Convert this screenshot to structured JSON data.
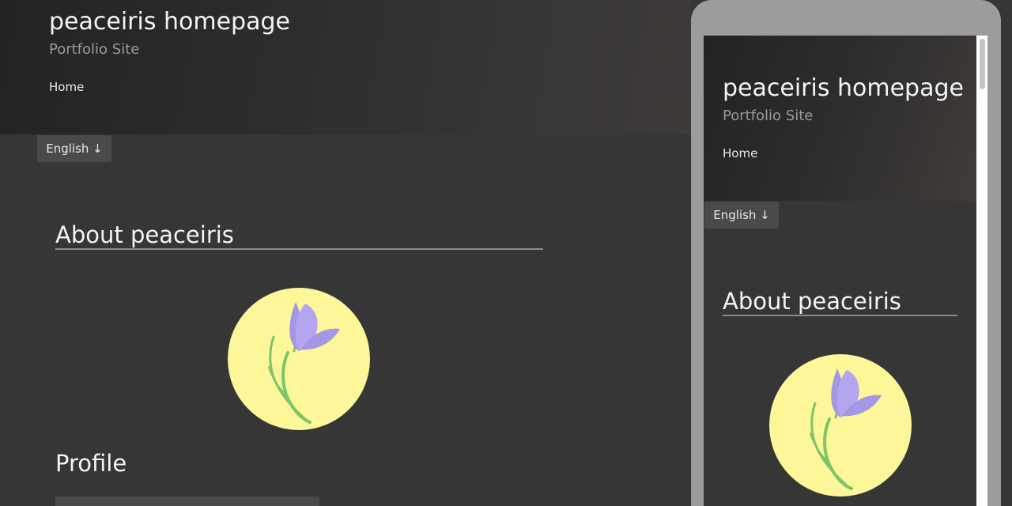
{
  "site": {
    "title": "peaceiris homepage",
    "subtitle": "Portfolio Site",
    "nav": {
      "home_label": "Home"
    },
    "language_button_label": "English ↓"
  },
  "main": {
    "about_heading": "About peaceiris",
    "profile_heading": "Profile",
    "avatar": {
      "icon": "iris-flower-icon",
      "background_color": "#fdf79a"
    }
  },
  "colors": {
    "page_background": "#363636",
    "header_dark": "#242222",
    "button_background": "#4a4a4a",
    "phone_frame": "#9c9c9c",
    "flower_petal": "#a497e6",
    "flower_stem": "#7dc46a"
  }
}
